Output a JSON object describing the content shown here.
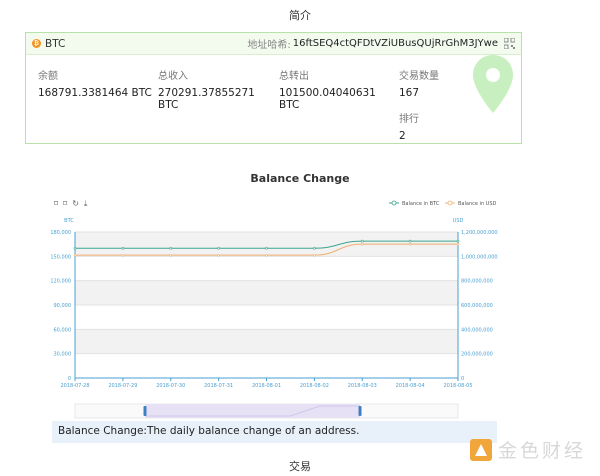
{
  "summary": {
    "section_title": "简介",
    "coin": "BTC",
    "address_label": "地址哈希:",
    "address": "16ftSEQ4ctQFDtVZiUBusQUjRrGhM3JYwe",
    "balance_label": "余额",
    "balance": "168791.3381464 BTC",
    "received_label": "总收入",
    "received_line1": "270291.37855271",
    "received_line2": "BTC",
    "sent_label": "总转出",
    "sent_line1": "101500.04040631",
    "sent_line2": "BTC",
    "txcount_label": "交易数量",
    "txcount": "167",
    "rank_label": "排行",
    "rank": "2"
  },
  "chart_title": "Balance Change",
  "note": "Balance Change:The daily balance change of an address.",
  "tx_section_title": "交易",
  "watermark": "金色财经",
  "chart_data": {
    "type": "line",
    "x": [
      "2018-07-28",
      "2018-07-29",
      "2018-07-30",
      "2018-07-31",
      "2018-08-01",
      "2018-08-02",
      "2018-08-03",
      "2018-08-04",
      "2018-08-05"
    ],
    "series": [
      {
        "name": "Balance in BTC",
        "axis": "left",
        "color": "#3aa58f",
        "values": [
          160000,
          160000,
          160000,
          160000,
          160000,
          160000,
          168800,
          168800,
          168800
        ]
      },
      {
        "name": "Balance in USD",
        "axis": "right",
        "color": "#f0b070",
        "values": [
          1010000000,
          1010000000,
          1010000000,
          1010000000,
          1010000000,
          1010000000,
          1100000000,
          1100000000,
          1100000000
        ]
      }
    ],
    "ylabel_left": "BTC",
    "ylabel_right": "USD",
    "ylim_left": [
      0,
      180000
    ],
    "ylim_right": [
      0,
      1200000000
    ],
    "yticks_left": [
      "0",
      "30,000",
      "60,000",
      "90,000",
      "120,000",
      "150,000",
      "180,000"
    ],
    "yticks_right": [
      "0",
      "200,000,000",
      "400,000,000",
      "600,000,000",
      "800,000,000",
      "1,000,000,000",
      "1,200,000,000"
    ],
    "legend_position": "top-right",
    "grid": true
  },
  "colors": {
    "card_border": "#b7e3a8",
    "btc_line": "#3aa58f",
    "usd_line": "#f0b070",
    "axis": "#4a9fd0",
    "pin": "#c8efc0"
  }
}
